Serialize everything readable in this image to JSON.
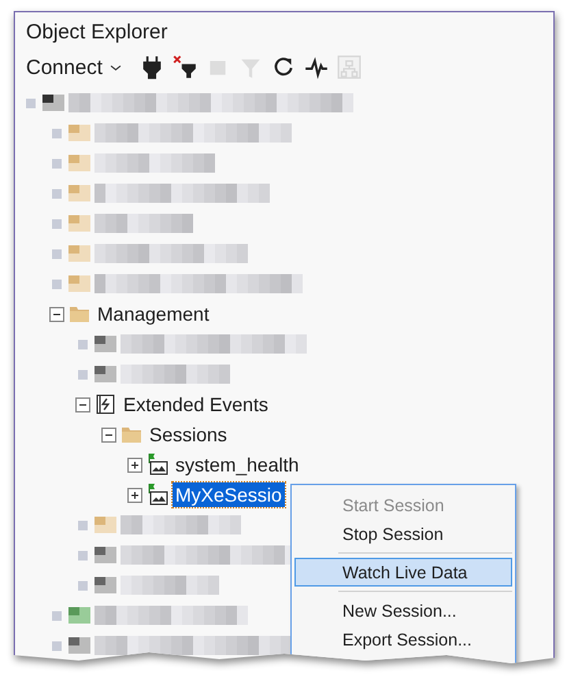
{
  "panel": {
    "title": "Object Explorer"
  },
  "toolbar": {
    "connect": {
      "label": "Connect"
    },
    "tools": [
      {
        "kind": "connect",
        "disabled": false
      },
      {
        "kind": "disconnect",
        "disabled": false
      },
      {
        "kind": "stop",
        "disabled": true
      },
      {
        "kind": "filter",
        "disabled": true
      },
      {
        "kind": "refresh",
        "disabled": false
      },
      {
        "kind": "activity",
        "disabled": false
      },
      {
        "kind": "diagram",
        "disabled": true
      }
    ]
  },
  "tree": [
    {
      "kind": "redacted-server",
      "expanded": true,
      "children": [
        {
          "kind": "redacted-folder"
        },
        {
          "kind": "redacted-folder"
        },
        {
          "kind": "redacted-folder"
        },
        {
          "kind": "redacted-folder"
        },
        {
          "kind": "redacted-folder"
        },
        {
          "kind": "redacted-folder"
        },
        {
          "kind": "folder",
          "label": "Management",
          "expanded": true,
          "selected": false,
          "children": [
            {
              "kind": "redacted-object"
            },
            {
              "kind": "redacted-object"
            },
            {
              "kind": "events",
              "label": "Extended Events",
              "expanded": true,
              "selected": false,
              "children": [
                {
                  "kind": "folder",
                  "label": "Sessions",
                  "expanded": true,
                  "selected": false,
                  "children": [
                    {
                      "kind": "session",
                      "label": "system_health",
                      "expanded": false,
                      "selected": false
                    },
                    {
                      "kind": "session",
                      "label": "MyXeSessio",
                      "expanded": false,
                      "selected": true
                    }
                  ]
                }
              ]
            },
            {
              "kind": "redacted-folder"
            },
            {
              "kind": "redacted-object"
            },
            {
              "kind": "redacted-object"
            }
          ]
        },
        {
          "kind": "redacted-agent"
        },
        {
          "kind": "redacted-object"
        }
      ]
    }
  ],
  "context_menu": [
    {
      "kind": "item",
      "label": "Start Session",
      "disabled": true,
      "selected": false
    },
    {
      "kind": "item",
      "label": "Stop Session",
      "disabled": false,
      "selected": false
    },
    {
      "kind": "separator"
    },
    {
      "kind": "item",
      "label": "Watch Live Data",
      "disabled": false,
      "selected": true
    },
    {
      "kind": "separator"
    },
    {
      "kind": "item",
      "label": "New Session...",
      "disabled": false,
      "selected": false
    },
    {
      "kind": "item",
      "label": "Export Session...",
      "disabled": false,
      "selected": false
    }
  ]
}
